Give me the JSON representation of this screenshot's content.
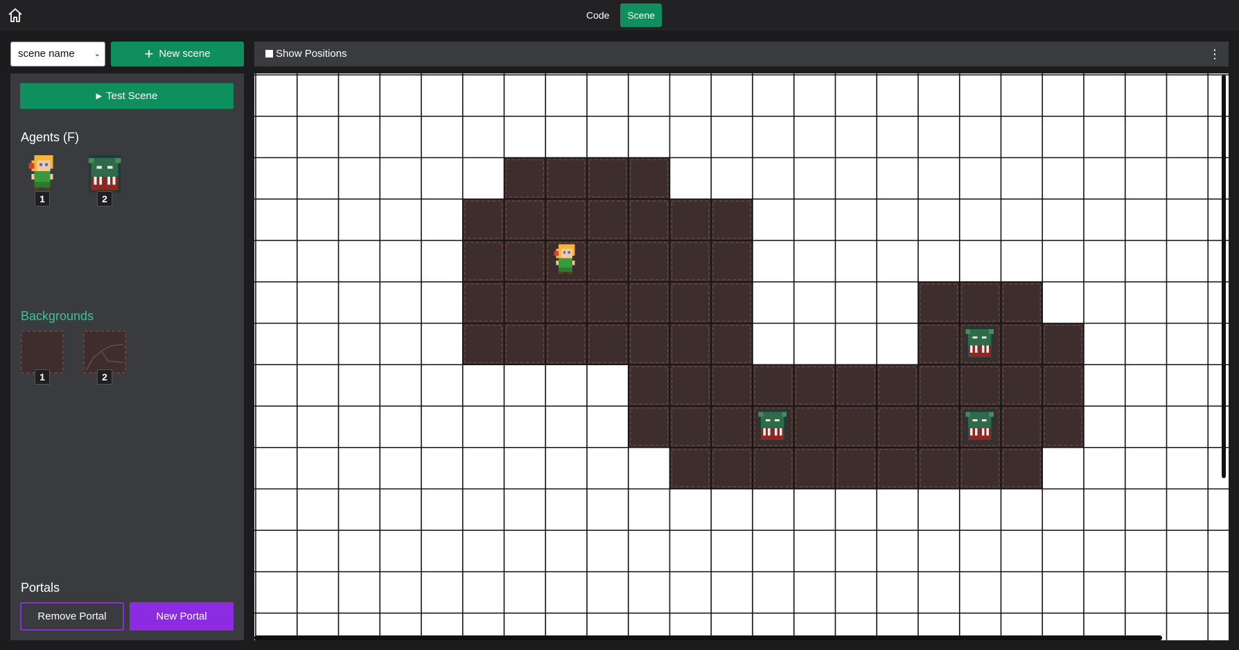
{
  "topbar": {
    "tabs": [
      {
        "label": "Code",
        "active": false
      },
      {
        "label": "Scene",
        "active": true
      }
    ]
  },
  "scene_selector": {
    "value": "scene name"
  },
  "new_scene_button": {
    "label": "New scene"
  },
  "sidebar": {
    "test_scene_label": "Test Scene",
    "agents": {
      "title": "Agents (F)",
      "items": [
        {
          "badge": "1",
          "sprite": "hero-girl"
        },
        {
          "badge": "2",
          "sprite": "orc-monster"
        }
      ]
    },
    "backgrounds": {
      "title": "Backgrounds",
      "items": [
        {
          "badge": "1",
          "tile": "floor-plain"
        },
        {
          "badge": "2",
          "tile": "floor-cracked"
        }
      ]
    },
    "portals": {
      "title": "Portals",
      "remove_label": "Remove Portal",
      "new_label": "New Portal"
    }
  },
  "editor": {
    "show_positions_label": "Show Positions",
    "show_positions_checked": false,
    "grid": {
      "columns": 24,
      "rows": 14,
      "floor_rows": [
        [
          6,
          7,
          8,
          9
        ],
        [
          5,
          6,
          7,
          8,
          9,
          10,
          11
        ],
        [
          5,
          6,
          7,
          8,
          9,
          10,
          11
        ],
        [
          5,
          6,
          7,
          8,
          9,
          10,
          11,
          16,
          17,
          18
        ],
        [
          5,
          6,
          7,
          8,
          9,
          10,
          11,
          16,
          17,
          18,
          19
        ],
        [
          9,
          10,
          11,
          12,
          13,
          14,
          15,
          16,
          17,
          18,
          19
        ],
        [
          9,
          10,
          11,
          12,
          13,
          14,
          15,
          16,
          17,
          18,
          19
        ],
        [
          10,
          11,
          12,
          13,
          14,
          15,
          16,
          17,
          18
        ]
      ],
      "floor_start_row": 2,
      "agents": [
        {
          "sprite": "hero-girl",
          "col": 7,
          "row": 4
        },
        {
          "sprite": "orc-monster",
          "col": 17,
          "row": 6
        },
        {
          "sprite": "orc-monster",
          "col": 12,
          "row": 8
        },
        {
          "sprite": "orc-monster",
          "col": 17,
          "row": 8
        }
      ]
    }
  },
  "icons": {
    "home": "home-icon",
    "play": "play-icon",
    "plus": "plus-icon",
    "kebab": "kebab-menu-icon",
    "caret": "chevron-down-icon"
  },
  "colors": {
    "accent_green": "#0f8f5d",
    "backgrounds_green": "#3dc48f",
    "portal_purple": "#8b2be2",
    "floor_tile": "#3d2d2c",
    "floor_tile_border": "#6a4c47"
  }
}
